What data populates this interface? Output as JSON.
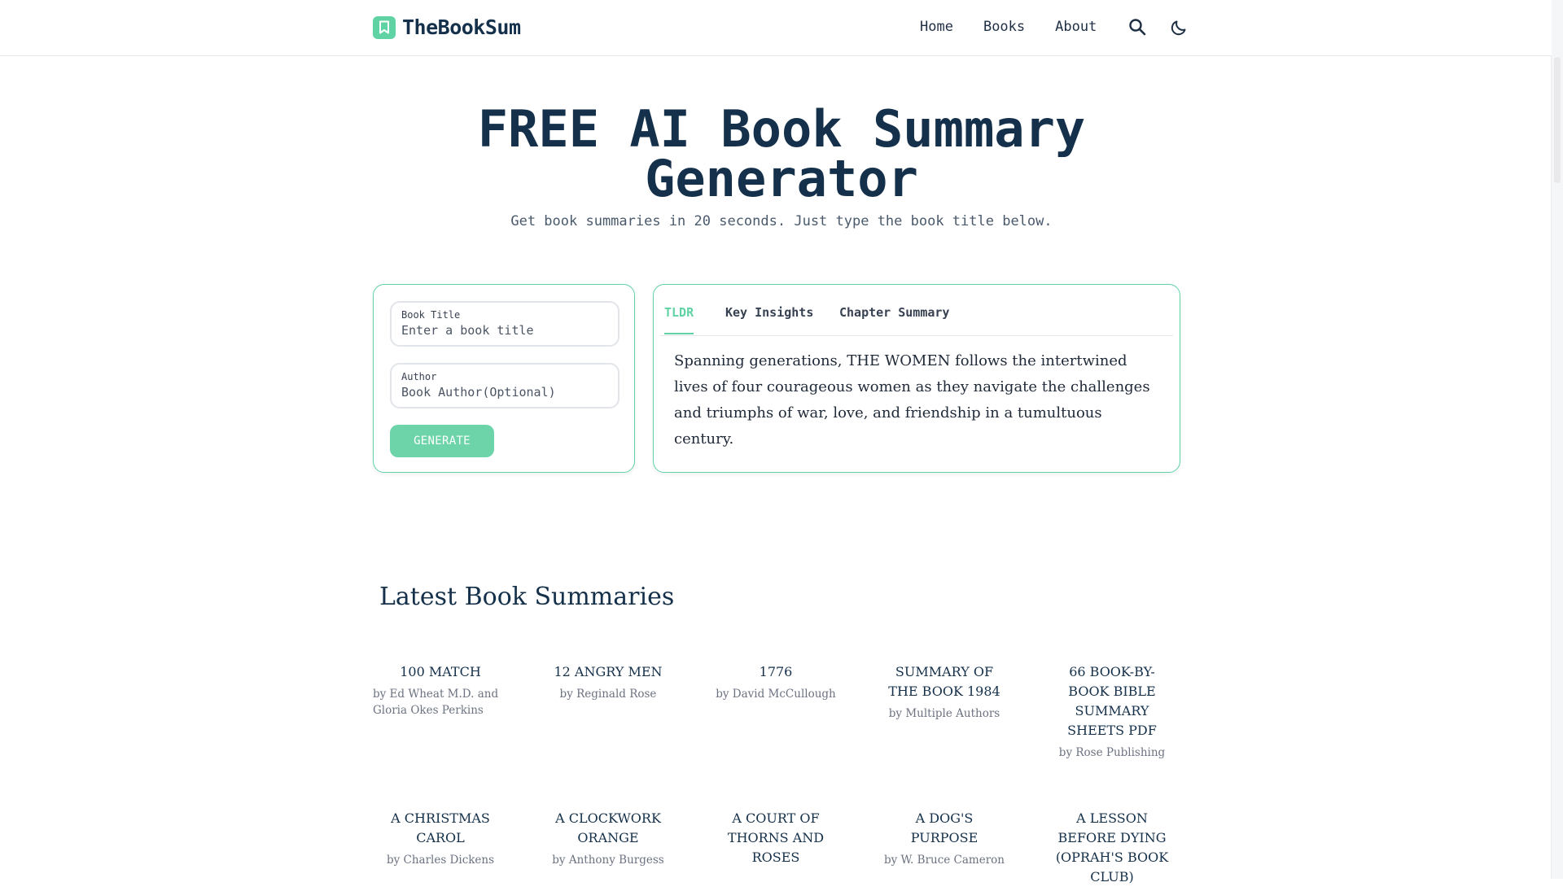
{
  "brand": {
    "name": "TheBookSum"
  },
  "nav": {
    "home": "Home",
    "books": "Books",
    "about": "About"
  },
  "hero": {
    "title_line1": "FREE AI Book Summary",
    "title_line2": "Generator",
    "subtitle": "Get book summaries in 20 seconds. Just type the book title below."
  },
  "form": {
    "title_label": "Book Title",
    "title_placeholder": "Enter a book title",
    "author_label": "Author",
    "author_placeholder": "Book Author(Optional)",
    "generate_label": "GENERATE"
  },
  "summary": {
    "tabs": [
      "TLDR",
      "Key Insights",
      "Chapter Summary"
    ],
    "active_tab": "TLDR",
    "text": "Spanning generations, THE WOMEN follows the intertwined lives of four courageous women as they navigate the challenges and triumphs of war, love, and friendship in a tumultuous century."
  },
  "latest": {
    "heading": "Latest Book Summaries",
    "books": [
      {
        "title": "100 MATCH",
        "author": "by Ed Wheat M.D. and Gloria Okes Perkins"
      },
      {
        "title": "12 ANGRY MEN",
        "author": "by Reginald Rose"
      },
      {
        "title": "1776",
        "author": "by David McCullough"
      },
      {
        "title": "SUMMARY OF THE BOOK 1984",
        "author": "by Multiple Authors"
      },
      {
        "title": "66 BOOK-BY-BOOK BIBLE SUMMARY SHEETS PDF",
        "author": "by Rose Publishing"
      },
      {
        "title": "A CHRISTMAS CAROL",
        "author": "by Charles Dickens"
      },
      {
        "title": "A CLOCKWORK ORANGE",
        "author": "by Anthony Burgess"
      },
      {
        "title": "A COURT OF THORNS AND ROSES",
        "author": ""
      },
      {
        "title": "A DOG'S PURPOSE",
        "author": "by W. Bruce Cameron"
      },
      {
        "title": "A LESSON BEFORE DYING (OPRAH'S BOOK CLUB)",
        "author": ""
      }
    ]
  },
  "colors": {
    "accent": "#5fd3a4",
    "heading": "#14304a"
  },
  "icons": [
    "bookmark-icon",
    "search-icon",
    "moon-icon"
  ]
}
